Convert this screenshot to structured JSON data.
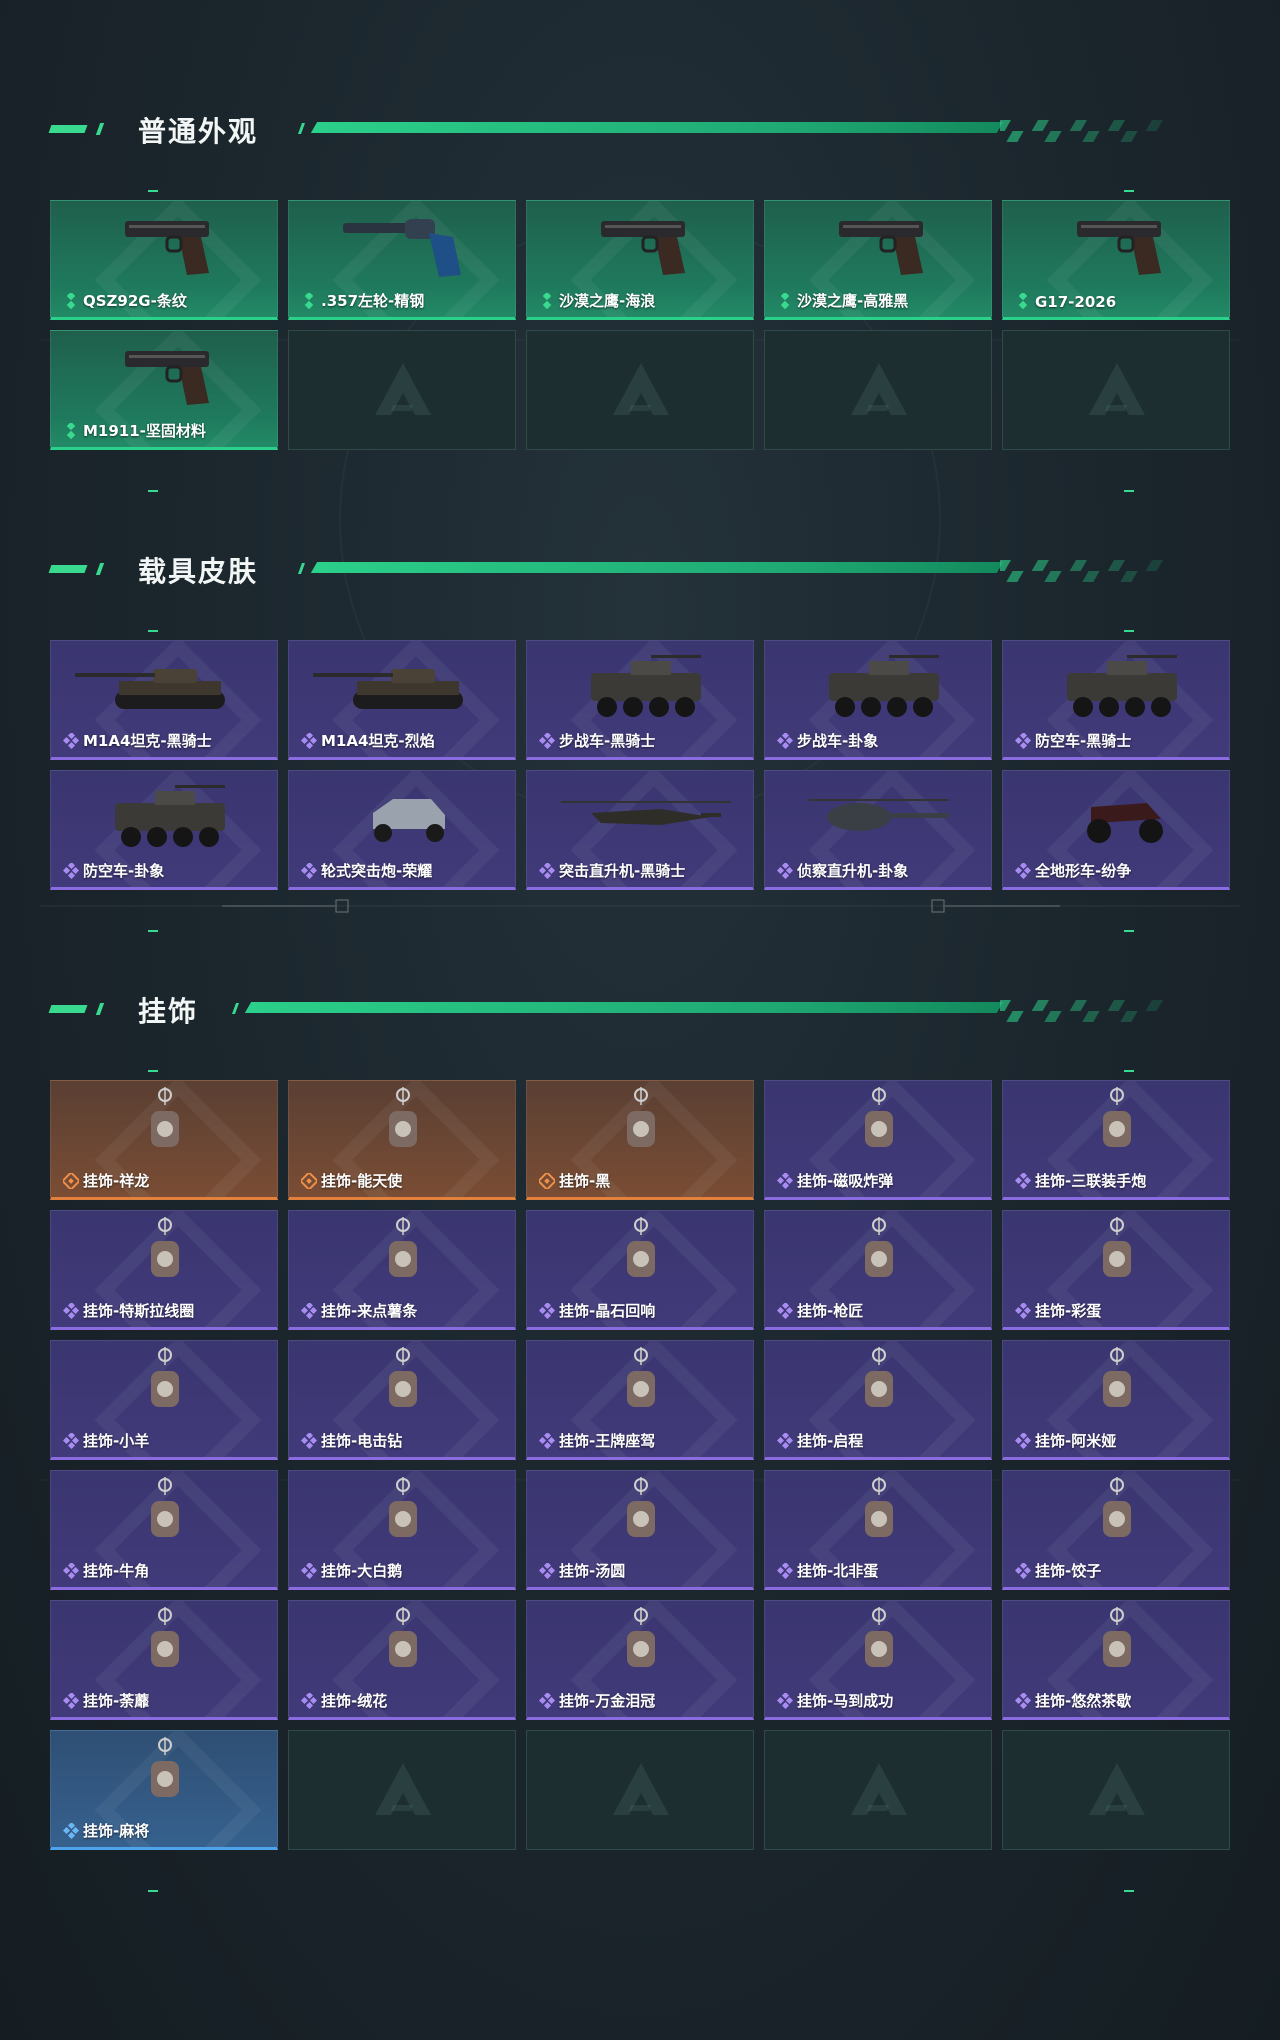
{
  "sections": [
    {
      "title": "普通外观",
      "items": [
        {
          "label": "QSZ92G-条纹",
          "rarity": "green",
          "icon": "pistol-icon"
        },
        {
          "label": ".357左轮-精钢",
          "rarity": "green",
          "icon": "revolver-icon"
        },
        {
          "label": "沙漠之鹰-海浪",
          "rarity": "green",
          "icon": "pistol-icon"
        },
        {
          "label": "沙漠之鹰-高雅黑",
          "rarity": "green",
          "icon": "pistol-icon"
        },
        {
          "label": "G17-2026",
          "rarity": "green",
          "icon": "pistol-icon"
        },
        {
          "label": "M1911-坚固材料",
          "rarity": "green",
          "icon": "pistol-icon"
        }
      ],
      "empty_slots": 4
    },
    {
      "title": "载具皮肤",
      "items": [
        {
          "label": "M1A4坦克-黑骑士",
          "rarity": "purple",
          "icon": "tank-icon"
        },
        {
          "label": "M1A4坦克-烈焰",
          "rarity": "purple",
          "icon": "tank-icon"
        },
        {
          "label": "步战车-黑骑士",
          "rarity": "purple",
          "icon": "ifv-icon"
        },
        {
          "label": "步战车-卦象",
          "rarity": "purple",
          "icon": "ifv-icon"
        },
        {
          "label": "防空车-黑骑士",
          "rarity": "purple",
          "icon": "ifv-icon"
        },
        {
          "label": "防空车-卦象",
          "rarity": "purple",
          "icon": "ifv-icon"
        },
        {
          "label": "轮式突击炮-荣耀",
          "rarity": "purple",
          "icon": "buggy-icon"
        },
        {
          "label": "突击直升机-黑骑士",
          "rarity": "purple",
          "icon": "attack-helicopter-icon"
        },
        {
          "label": "侦察直升机-卦象",
          "rarity": "purple",
          "icon": "scout-helicopter-icon"
        },
        {
          "label": "全地形车-纷争",
          "rarity": "purple",
          "icon": "atv-icon"
        }
      ],
      "empty_slots": 0
    },
    {
      "title": "挂饰",
      "items": [
        {
          "label": "挂饰-祥龙",
          "rarity": "orange",
          "icon": "charm-icon"
        },
        {
          "label": "挂饰-能天使",
          "rarity": "orange",
          "icon": "charm-icon"
        },
        {
          "label": "挂饰-黑",
          "rarity": "orange",
          "icon": "charm-icon"
        },
        {
          "label": "挂饰-磁吸炸弹",
          "rarity": "purple",
          "icon": "charm-icon"
        },
        {
          "label": "挂饰-三联装手炮",
          "rarity": "purple",
          "icon": "charm-icon"
        },
        {
          "label": "挂饰-特斯拉线圈",
          "rarity": "purple",
          "icon": "charm-icon"
        },
        {
          "label": "挂饰-来点薯条",
          "rarity": "purple",
          "icon": "charm-icon"
        },
        {
          "label": "挂饰-晶石回响",
          "rarity": "purple",
          "icon": "charm-icon"
        },
        {
          "label": "挂饰-枪匠",
          "rarity": "purple",
          "icon": "charm-icon"
        },
        {
          "label": "挂饰-彩蛋",
          "rarity": "purple",
          "icon": "charm-icon"
        },
        {
          "label": "挂饰-小羊",
          "rarity": "purple",
          "icon": "charm-icon"
        },
        {
          "label": "挂饰-电击钻",
          "rarity": "purple",
          "icon": "charm-icon"
        },
        {
          "label": "挂饰-王牌座驾",
          "rarity": "purple",
          "icon": "charm-icon"
        },
        {
          "label": "挂饰-启程",
          "rarity": "purple",
          "icon": "charm-icon"
        },
        {
          "label": "挂饰-阿米娅",
          "rarity": "purple",
          "icon": "charm-icon"
        },
        {
          "label": "挂饰-牛角",
          "rarity": "purple",
          "icon": "charm-icon"
        },
        {
          "label": "挂饰-大白鹅",
          "rarity": "purple",
          "icon": "charm-icon"
        },
        {
          "label": "挂饰-汤圆",
          "rarity": "purple",
          "icon": "charm-icon"
        },
        {
          "label": "挂饰-北非蛋",
          "rarity": "purple",
          "icon": "charm-icon"
        },
        {
          "label": "挂饰-饺子",
          "rarity": "purple",
          "icon": "charm-icon"
        },
        {
          "label": "挂饰-荼蘼",
          "rarity": "purple",
          "icon": "charm-icon"
        },
        {
          "label": "挂饰-绒花",
          "rarity": "purple",
          "icon": "charm-icon"
        },
        {
          "label": "挂饰-万金泪冠",
          "rarity": "purple",
          "icon": "charm-icon"
        },
        {
          "label": "挂饰-马到成功",
          "rarity": "purple",
          "icon": "charm-icon"
        },
        {
          "label": "挂饰-悠然茶歇",
          "rarity": "purple",
          "icon": "charm-icon"
        },
        {
          "label": "挂饰-麻将",
          "rarity": "blue",
          "icon": "charm-icon"
        }
      ],
      "empty_slots": 4
    }
  ],
  "colors": {
    "accent": "#2bd08a",
    "green": "#228a66",
    "purple": "#8b6ce0",
    "orange": "#e1813d",
    "blue": "#4fa3ea"
  }
}
